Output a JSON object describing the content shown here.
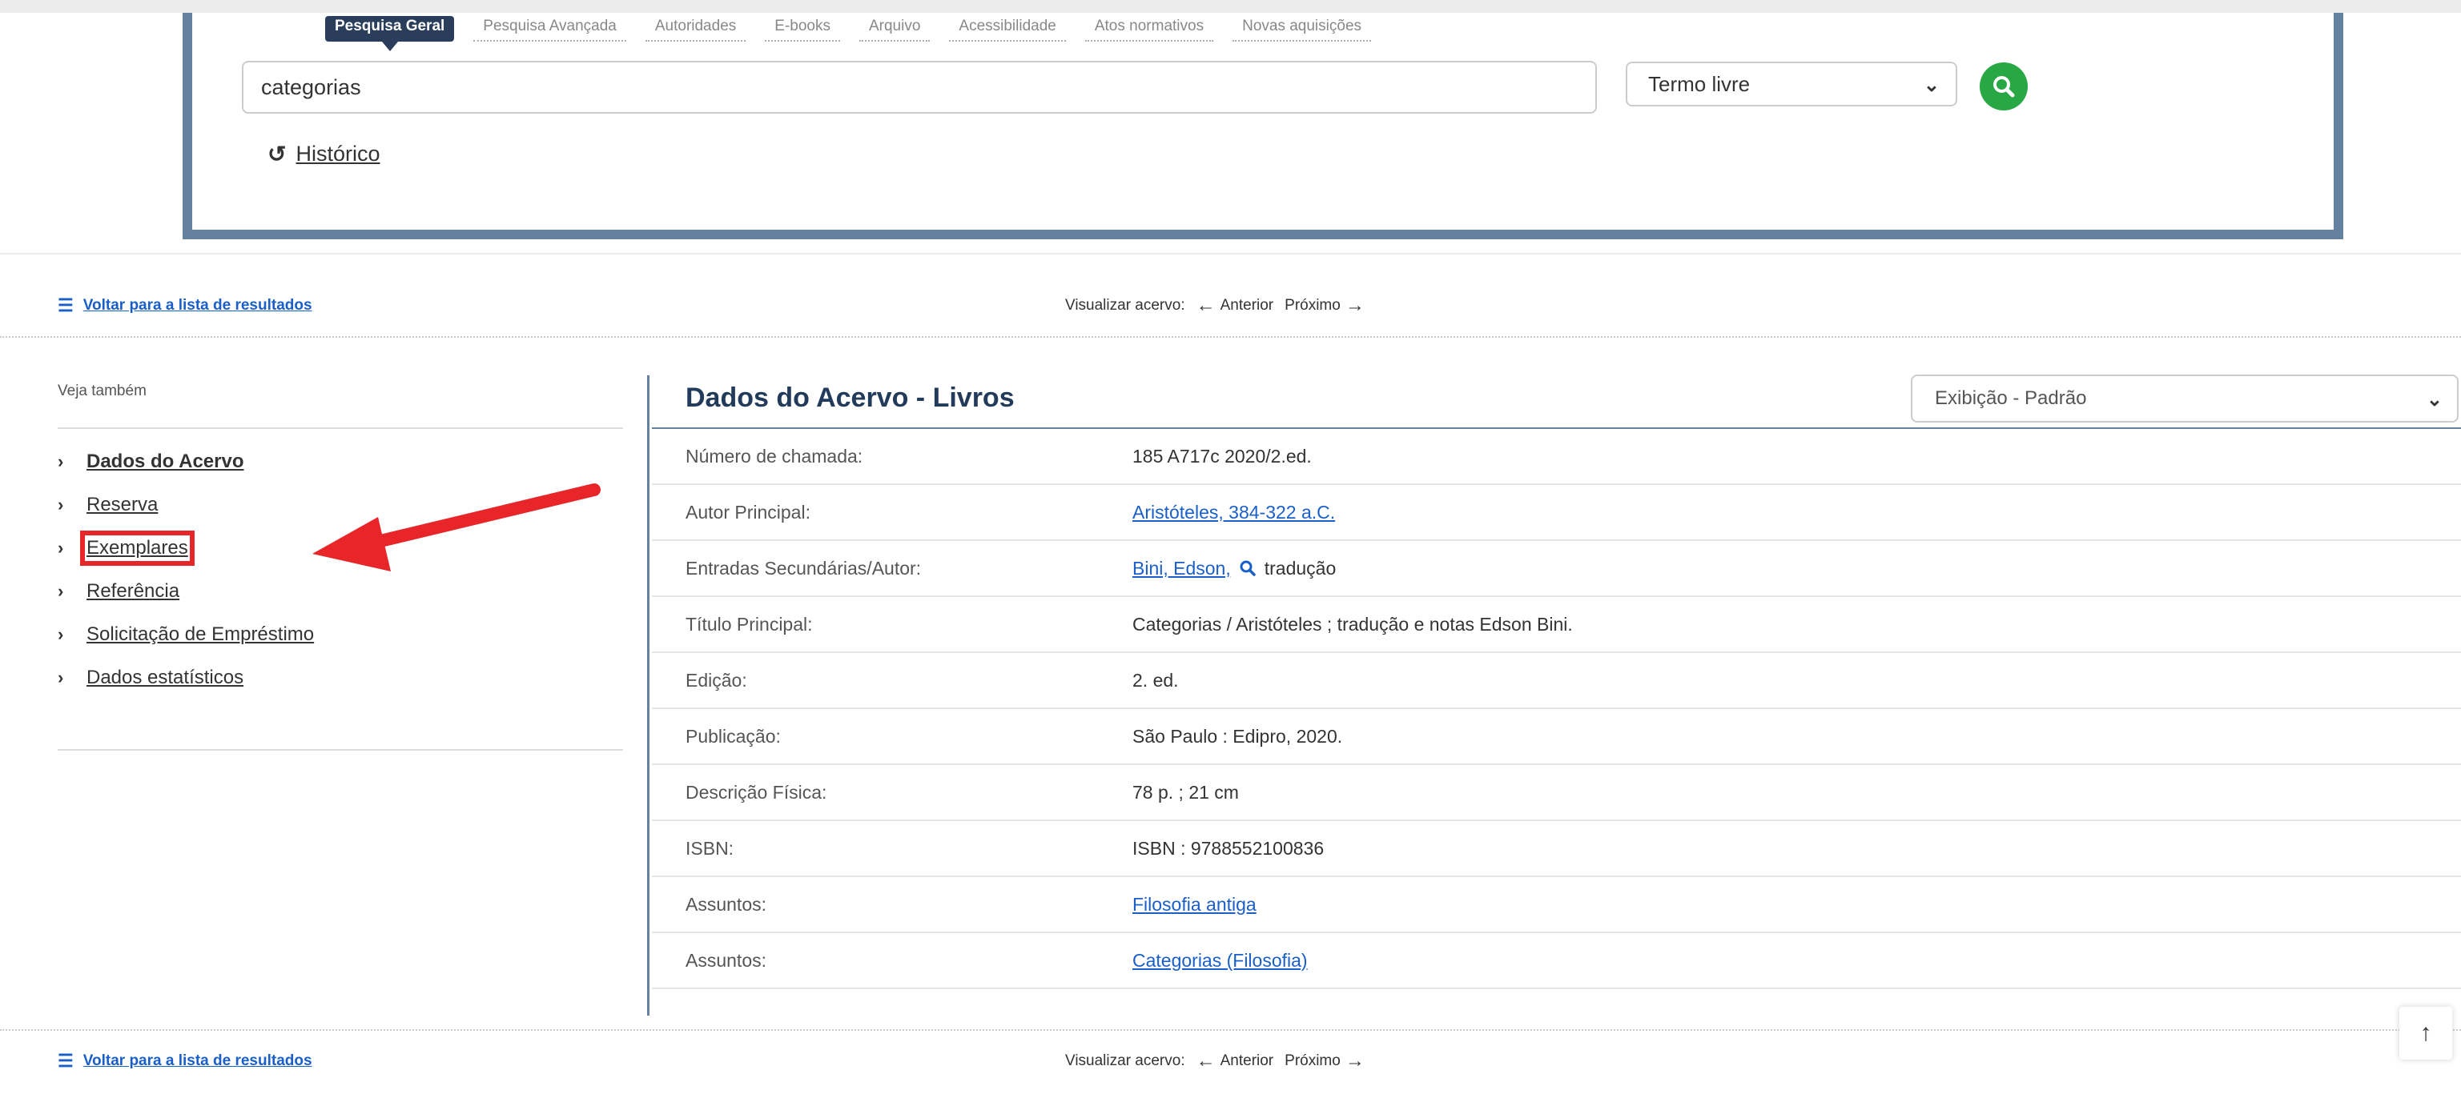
{
  "search": {
    "tabs": [
      "Pesquisa Geral",
      "Pesquisa Avançada",
      "Autoridades",
      "E-books",
      "Arquivo",
      "Acessibilidade",
      "Atos normativos",
      "Novas aquisições"
    ],
    "query": "categorias",
    "field_select": "Termo livre",
    "history_label": "Histórico"
  },
  "nav": {
    "back_label": "Voltar para a lista de resultados",
    "visualizar_label": "Visualizar acervo:",
    "prev_label": "Anterior",
    "next_label": "Próximo"
  },
  "sidebar": {
    "heading": "Veja também",
    "items": [
      {
        "label": "Dados do Acervo"
      },
      {
        "label": "Reserva"
      },
      {
        "label": "Exemplares"
      },
      {
        "label": "Referência"
      },
      {
        "label": "Solicitação de Empréstimo"
      },
      {
        "label": "Dados estatísticos"
      }
    ]
  },
  "record": {
    "title": "Dados do Acervo - Livros",
    "view_select": "Exibição - Padrão",
    "fields": [
      {
        "key": "Número de chamada:",
        "value": "185  A717c  2020/2.ed."
      },
      {
        "key": "Autor Principal:",
        "value": "Aristóteles, 384-322 a.C."
      },
      {
        "key": "Entradas Secundárias/Autor:",
        "value": "Bini, Edson,",
        "suffix": "tradução"
      },
      {
        "key": "Título Principal:",
        "value": "Categorias /  Aristóteles ; tradução e notas Edson Bini."
      },
      {
        "key": "Edição:",
        "value": "2. ed."
      },
      {
        "key": "Publicação:",
        "value": "São Paulo :  Edipro,  2020."
      },
      {
        "key": "Descrição Física:",
        "value": "78 p. ;  21 cm"
      },
      {
        "key": "ISBN:",
        "value": "ISBN : 9788552100836"
      },
      {
        "key": "Assuntos:",
        "value": "Filosofia antiga"
      },
      {
        "key": "Assuntos:",
        "value": "Categorias (Filosofia)"
      }
    ]
  },
  "colors": {
    "panel_border": "#64819f",
    "title": "#233b5b",
    "link": "#1a5fc9",
    "search_button": "#28a745",
    "annotation_red": "#e8262a"
  }
}
